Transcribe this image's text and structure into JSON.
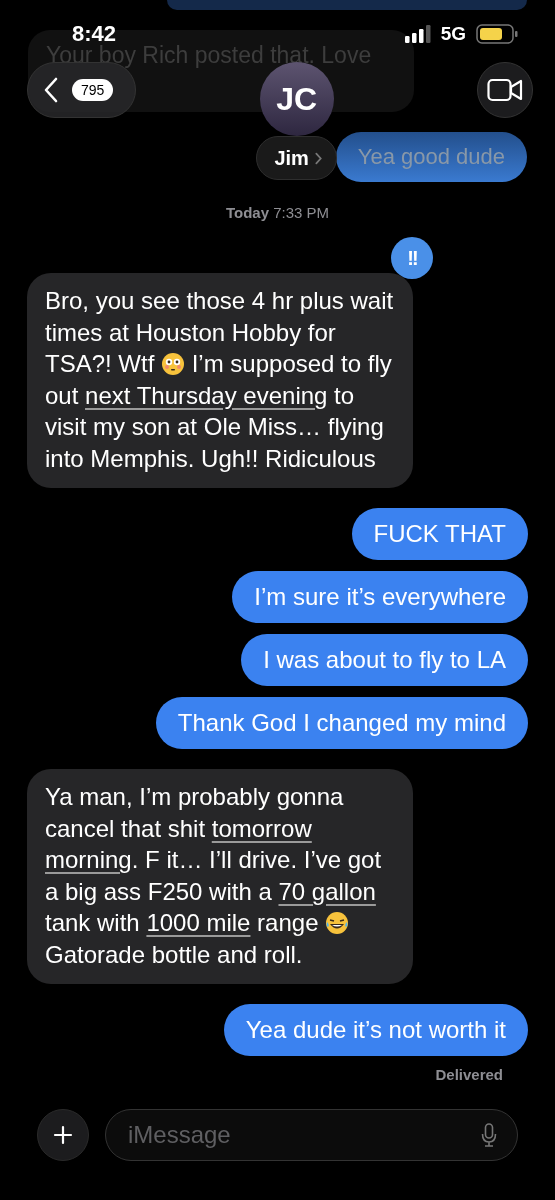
{
  "status_bar": {
    "time": "8:42",
    "network": "5G"
  },
  "header": {
    "back_badge": "795",
    "avatar_initials": "JC",
    "contact_name": "Jim"
  },
  "background_messages": [
    {
      "kind": "received",
      "text": "Your boy Rich posted that. Love"
    },
    {
      "kind": "sent",
      "text": "Yea good dude"
    }
  ],
  "timestamp": "**Today** 7:33 PM",
  "messages": [
    {
      "kind": "received",
      "tapback": "!!",
      "parts": [
        {
          "kind": "text",
          "text": "Bro, you see those 4 hr plus wait times at Houston Hobby for TSA?! Wtf "
        },
        {
          "kind": "flushed"
        },
        {
          "kind": "text",
          "text": " I’m supposed to fly out "
        },
        {
          "kind": "link",
          "text": "next Thursday evening"
        },
        {
          "kind": "text",
          "text": " to visit my son at Ole Miss… flying into Memphis. Ugh!! Ridiculous"
        }
      ]
    },
    {
      "kind": "sent",
      "parts": [
        {
          "kind": "text",
          "text": "FUCK THAT"
        }
      ]
    },
    {
      "kind": "sent",
      "parts": [
        {
          "kind": "text",
          "text": "I’m sure it’s everywhere"
        }
      ]
    },
    {
      "kind": "sent",
      "parts": [
        {
          "kind": "text",
          "text": "I was about to fly to LA"
        }
      ]
    },
    {
      "kind": "sent",
      "parts": [
        {
          "kind": "text",
          "text": "Thank God I changed my mind"
        }
      ]
    },
    {
      "kind": "received",
      "parts": [
        {
          "kind": "text",
          "text": "Ya man, I’m probably gonna cancel that shit "
        },
        {
          "kind": "link",
          "text": "tomorrow"
        },
        {
          "kind": "link",
          "text": "morning"
        },
        {
          "kind": "text",
          "text": ". F it… I’ll drive. I’ve got a big ass F250 with a "
        },
        {
          "kind": "link",
          "text": "70 gallon"
        },
        {
          "kind": "text",
          "text": " tank with "
        },
        {
          "kind": "link",
          "text": "1000 mile"
        },
        {
          "kind": "text",
          "text": " range "
        },
        {
          "kind": "laughing"
        },
        {
          "kind": "text",
          "text": " Gatorade bottle and roll."
        }
      ]
    },
    {
      "kind": "sent",
      "parts": [
        {
          "kind": "text",
          "text": "Yea dude it’s not worth it"
        }
      ]
    }
  ],
  "delivered": "Delivered",
  "input": {
    "placeholder": "iMessage"
  }
}
